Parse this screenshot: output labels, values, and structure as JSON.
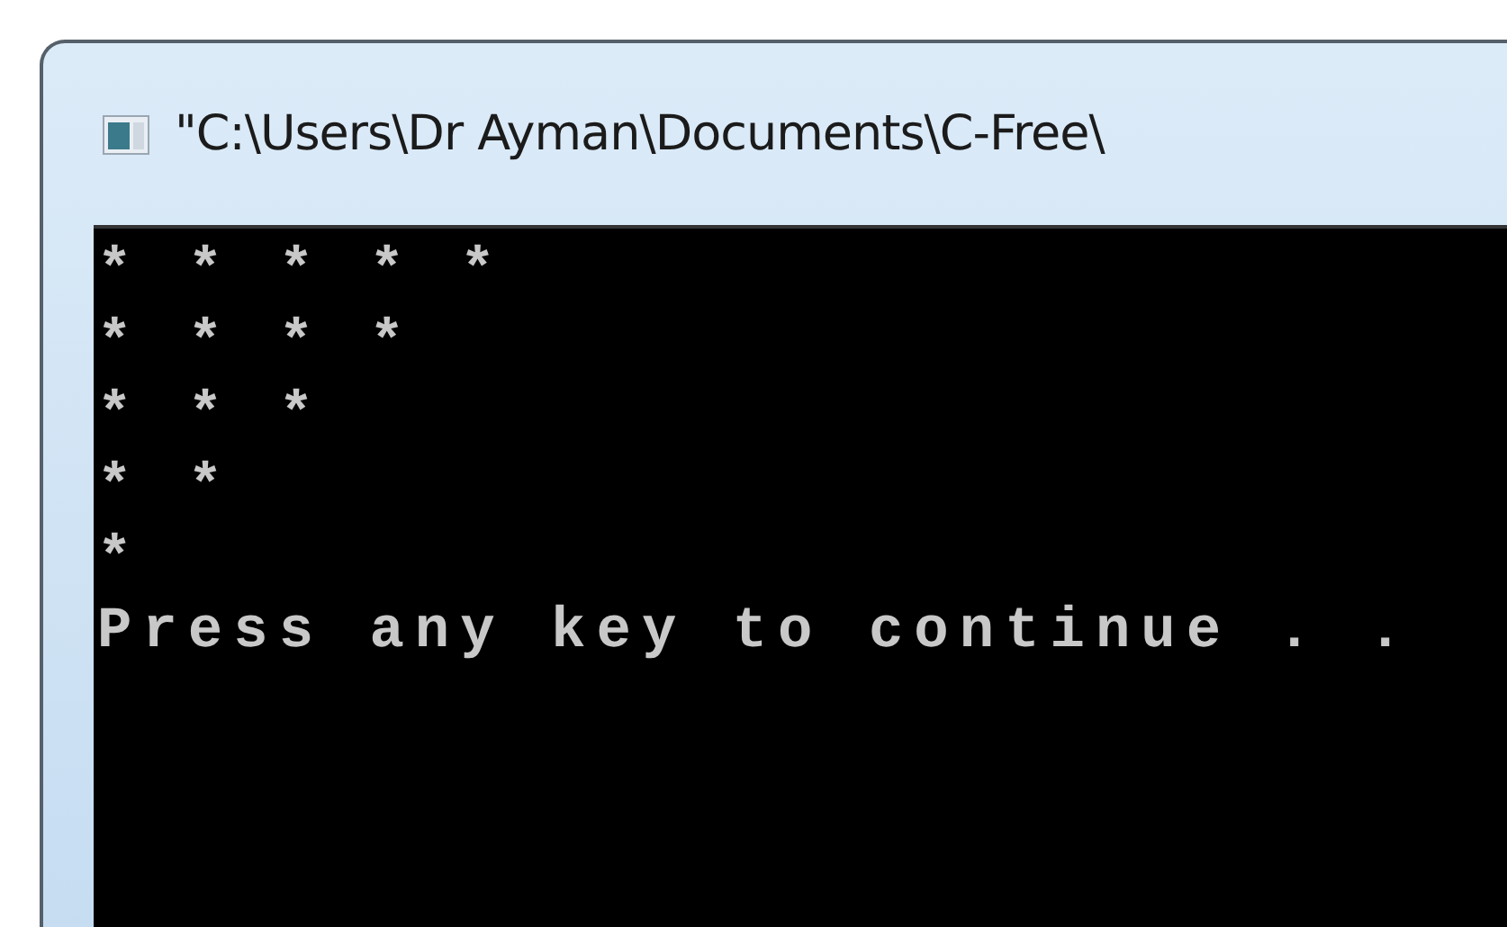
{
  "window": {
    "title": "\"C:\\Users\\Dr Ayman\\Documents\\C-Free\\"
  },
  "console": {
    "lines": [
      "* * * * *",
      "* * * *",
      "* * *",
      "* *",
      "*",
      "Press any key to continue . ."
    ]
  }
}
